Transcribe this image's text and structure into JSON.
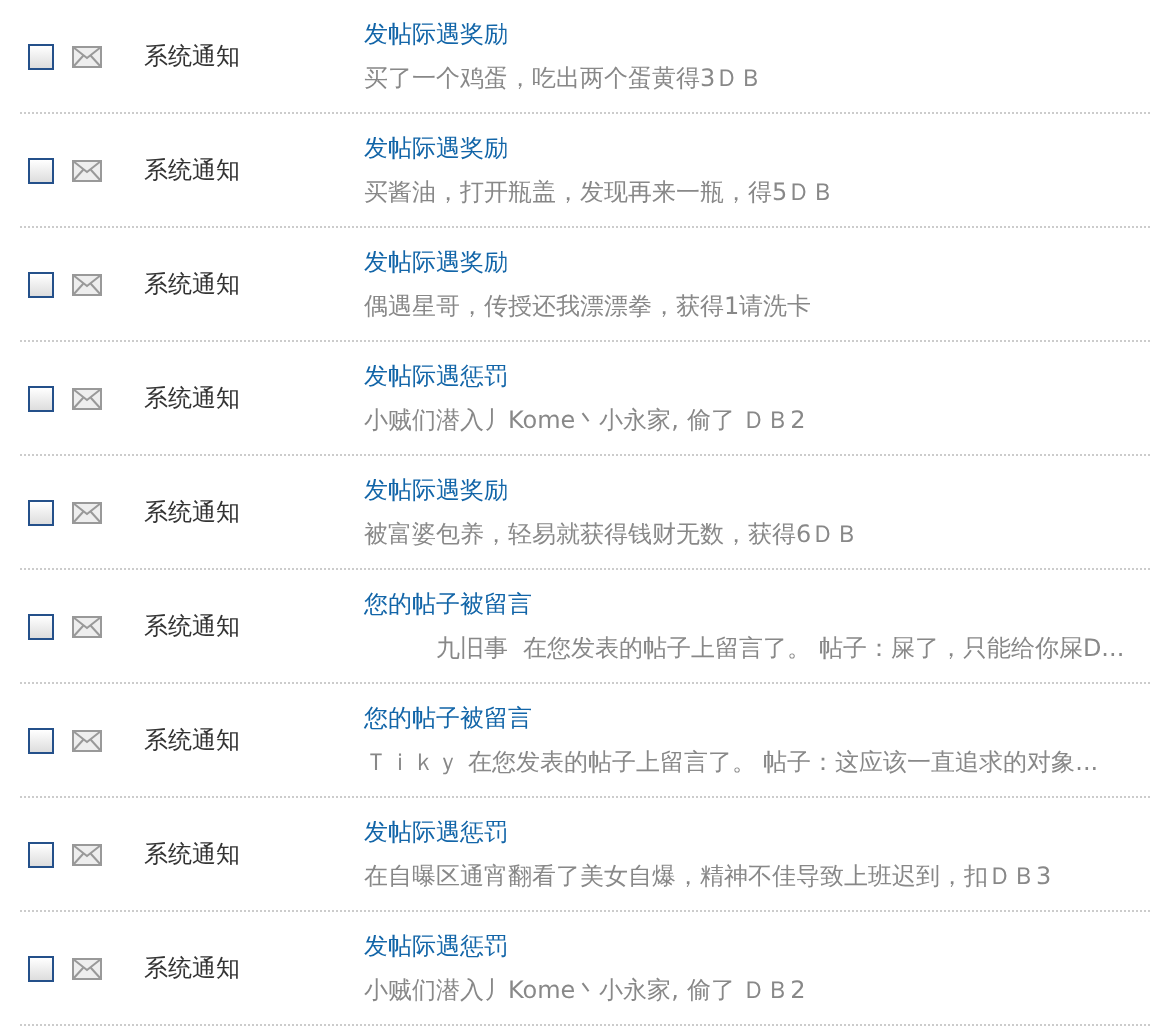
{
  "messages": [
    {
      "checked": false,
      "sender": "系统通知",
      "title": "发帖际遇奖励",
      "body": "买了一个鸡蛋，吃出两个蛋黄得3ＤＢ"
    },
    {
      "checked": false,
      "sender": "系统通知",
      "title": "发帖际遇奖励",
      "body": "买酱油，打开瓶盖，发现再来一瓶，得5ＤＢ"
    },
    {
      "checked": false,
      "sender": "系统通知",
      "title": "发帖际遇奖励",
      "body": "偶遇星哥，传授还我漂漂拳，获得1请洗卡"
    },
    {
      "checked": false,
      "sender": "系统通知",
      "title": "发帖际遇惩罚",
      "body": "小贼们潜入丿Kome丶小永家, 偷了 ＤＢ2"
    },
    {
      "checked": false,
      "sender": "系统通知",
      "title": "发帖际遇奖励",
      "body": "被富婆包养，轻易就获得钱财无数，获得6ＤＢ"
    },
    {
      "checked": false,
      "sender": "系统通知",
      "title": "您的帖子被留言",
      "body": "　　　九旧事  在您发表的帖子上留言了。 帖子：屎了，只能给你屎D..."
    },
    {
      "checked": false,
      "sender": "系统通知",
      "title": "您的帖子被留言",
      "body": "Ｔｉｋｙ 在您发表的帖子上留言了。 帖子：这应该一直追求的对象..."
    },
    {
      "checked": false,
      "sender": "系统通知",
      "title": "发帖际遇惩罚",
      "body": "在自曝区通宵翻看了美女自爆，精神不佳导致上班迟到，扣ＤＢ3"
    },
    {
      "checked": false,
      "sender": "系统通知",
      "title": "发帖际遇惩罚",
      "body": "小贼们潜入丿Kome丶小永家, 偷了 ＤＢ2"
    }
  ]
}
